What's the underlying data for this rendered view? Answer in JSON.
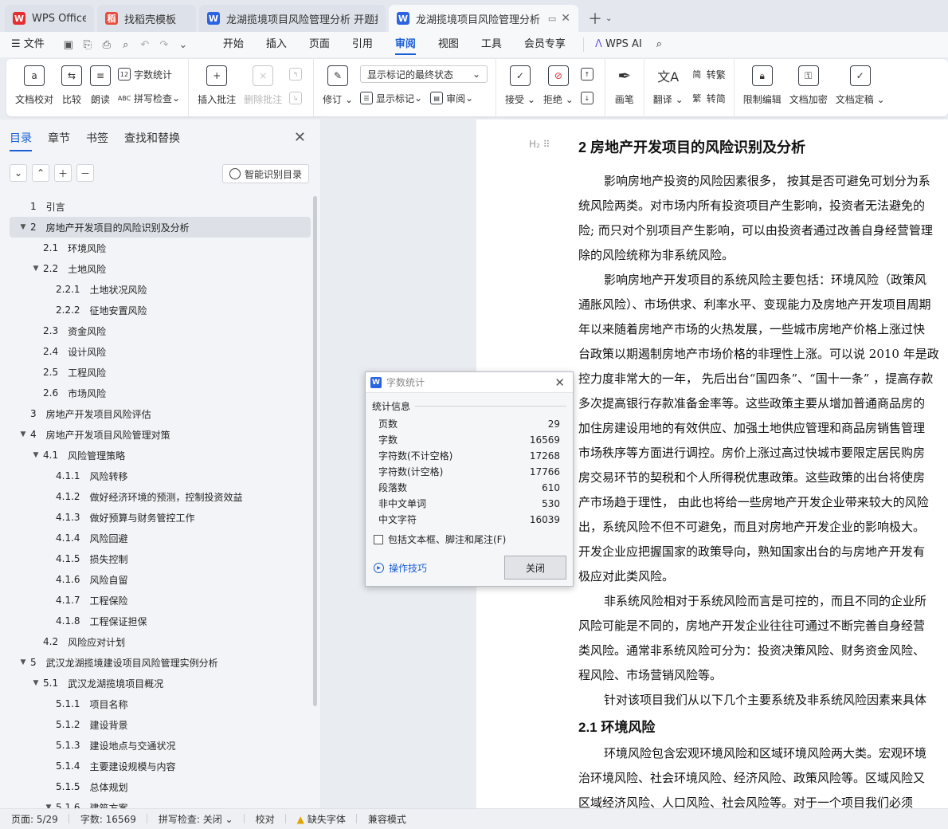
{
  "tabs": [
    {
      "label": "WPS Office",
      "icon": "wps-logo-icon",
      "color": "#e52e2e"
    },
    {
      "label": "找稻壳模板",
      "icon": "docer-icon",
      "color": "#e94c3d"
    },
    {
      "label": "龙湖揽境项目风险管理分析 开题报告",
      "icon": "writer-icon",
      "color": "#2b63e0"
    },
    {
      "label": "龙湖揽境项目风险管理分析 毕",
      "icon": "writer-icon",
      "color": "#2b63e0"
    }
  ],
  "menu": {
    "file": "文件",
    "items": [
      "开始",
      "插入",
      "页面",
      "引用",
      "审阅",
      "视图",
      "工具",
      "会员专享"
    ],
    "active": "审阅",
    "ai": "WPS AI"
  },
  "ribbon": {
    "doc_check": "文档校对",
    "compare": "比较",
    "read_aloud": "朗读",
    "word_count": "字数统计",
    "spell_check": "拼写检查",
    "insert_comment": "插入批注",
    "delete_comment": "删除批注",
    "revise": "修订",
    "markup_state": "显示标记的最终状态",
    "show_markup": "显示标记",
    "review": "审阅",
    "accept": "接受",
    "reject": "拒绝",
    "pen": "画笔",
    "translate": "翻译",
    "to_traditional": "转繁",
    "to_simplified": "转简",
    "restrict_edit": "限制编辑",
    "encrypt": "文档加密",
    "finalize": "文档定稿"
  },
  "panel": {
    "tabs": [
      "目录",
      "章节",
      "书签",
      "查找和替换"
    ],
    "smart_toc": "智能识别目录"
  },
  "toc": [
    {
      "num": "1",
      "title": "引言",
      "level": 1,
      "arrow": ""
    },
    {
      "num": "2",
      "title": "房地产开发项目的风险识别及分析",
      "level": 1,
      "arrow": "▼",
      "selected": true
    },
    {
      "num": "2.1",
      "title": "环境风险",
      "level": 2,
      "arrow": ""
    },
    {
      "num": "2.2",
      "title": "土地风险",
      "level": 2,
      "arrow": "▼"
    },
    {
      "num": "2.2.1",
      "title": "土地状况风险",
      "level": 3,
      "arrow": ""
    },
    {
      "num": "2.2.2",
      "title": "征地安置风险",
      "level": 3,
      "arrow": ""
    },
    {
      "num": "2.3",
      "title": "资金风险",
      "level": 2,
      "arrow": ""
    },
    {
      "num": "2.4",
      "title": "设计风险",
      "level": 2,
      "arrow": ""
    },
    {
      "num": "2.5",
      "title": "工程风险",
      "level": 2,
      "arrow": ""
    },
    {
      "num": "2.6",
      "title": "市场风险",
      "level": 2,
      "arrow": ""
    },
    {
      "num": "3",
      "title": "房地产开发项目风险评估",
      "level": 1,
      "arrow": ""
    },
    {
      "num": "4",
      "title": "房地产开发项目风险管理对策",
      "level": 1,
      "arrow": "▼"
    },
    {
      "num": "4.1",
      "title": "风险管理策略",
      "level": 2,
      "arrow": "▼"
    },
    {
      "num": "4.1.1",
      "title": "风险转移",
      "level": 3,
      "arrow": ""
    },
    {
      "num": "4.1.2",
      "title": "做好经济环境的预测，控制投资效益",
      "level": 3,
      "arrow": ""
    },
    {
      "num": "4.1.3",
      "title": "做好预算与财务管控工作",
      "level": 3,
      "arrow": ""
    },
    {
      "num": "4.1.4",
      "title": "风险回避",
      "level": 3,
      "arrow": ""
    },
    {
      "num": "4.1.5",
      "title": "损失控制",
      "level": 3,
      "arrow": ""
    },
    {
      "num": "4.1.6",
      "title": "风险自留",
      "level": 3,
      "arrow": ""
    },
    {
      "num": "4.1.7",
      "title": "工程保险",
      "level": 3,
      "arrow": ""
    },
    {
      "num": "4.1.8",
      "title": "工程保证担保",
      "level": 3,
      "arrow": ""
    },
    {
      "num": "4.2",
      "title": "风险应对计划",
      "level": 2,
      "arrow": ""
    },
    {
      "num": "5",
      "title": "武汉龙湖揽境建设项目风险管理实例分析",
      "level": 1,
      "arrow": "▼"
    },
    {
      "num": "5.1",
      "title": "武汉龙湖揽境项目概况",
      "level": 2,
      "arrow": "▼"
    },
    {
      "num": "5.1.1",
      "title": "项目名称",
      "level": 3,
      "arrow": ""
    },
    {
      "num": "5.1.2",
      "title": "建设背景",
      "level": 3,
      "arrow": ""
    },
    {
      "num": "5.1.3",
      "title": "建设地点与交通状况",
      "level": 3,
      "arrow": ""
    },
    {
      "num": "5.1.4",
      "title": "主要建设规模与内容",
      "level": 3,
      "arrow": ""
    },
    {
      "num": "5.1.5",
      "title": "总体规划",
      "level": 3,
      "arrow": ""
    },
    {
      "num": "5.1.6",
      "title": "建筑方案",
      "level": 3,
      "arrow": "▼"
    }
  ],
  "doc": {
    "heading_marker": "H₂",
    "h2": "2   房地产开发项目的风险识别及分析",
    "lines": [
      {
        "t": "影响房地产投资的风险因素很多，  按其是否可避免可划分为系",
        "indent": true
      },
      {
        "t": "统风险两类。对市场内所有投资项目产生影响，投资者无法避免的",
        "indent": false
      },
      {
        "t": "险; 而只对个别项目产生影响，可以由投资者通过改善自身经营管理",
        "indent": false
      },
      {
        "t": "除的风险统称为非系统风险。",
        "indent": false
      },
      {
        "t": "影响房地产开发项目的系统风险主要包括：环境风险（政策风",
        "indent": true
      },
      {
        "t": "通胀风险）、市场供求、利率水平、变现能力及房地产开发项目周期",
        "indent": false
      },
      {
        "t": "年以来随着房地产市场的火热发展，一些城市房地产价格上涨过快",
        "indent": false
      },
      {
        "t": "台政策以期遏制房地产市场价格的非理性上涨。可以说  2010 年是政",
        "indent": false
      },
      {
        "t": "控力度非常大的一年，  先后出台“国四条”、“国十一条” ，提高存款",
        "indent": false
      },
      {
        "t": "多次提高银行存款准备金率等。这些政策主要从增加普通商品房的",
        "indent": false
      },
      {
        "t": "加住房建设用地的有效供应、加强土地供应管理和商品房销售管理",
        "indent": false
      },
      {
        "t": "市场秩序等方面进行调控。房价上涨过高过快城市要限定居民购房",
        "indent": false
      },
      {
        "t": "房交易环节的契税和个人所得税优惠政策。这些政策的出台将使房",
        "indent": false
      },
      {
        "t": "产市场趋于理性，  由此也将给一些房地产开发企业带来较大的风险",
        "indent": false
      },
      {
        "t": "出，系统风险不但不可避免，而且对房地产开发企业的影响极大。",
        "indent": false
      },
      {
        "t": "开发企业应把握国家的政策导向，熟知国家出台的与房地产开发有",
        "indent": false
      },
      {
        "t": "极应对此类风险。",
        "indent": false
      },
      {
        "t": "非系统风险相对于系统风险而言是可控的，而且不同的企业所",
        "indent": true
      },
      {
        "t": "风险可能是不同的，房地产开发企业往往可通过不断完善自身经营",
        "indent": false
      },
      {
        "t": "类风险。通常非系统风险可分为：投资决策风险、财务资金风险、",
        "indent": false
      },
      {
        "t": "程风险、市场营销风险等。",
        "indent": false
      },
      {
        "t": "针对该项目我们从以下几个主要系统及非系统风险因素来具体",
        "indent": true
      }
    ],
    "h3": "2.1   环境风险",
    "lines2": [
      {
        "t": "环境风险包含宏观环境风险和区域环境风险两大类。宏观环境",
        "indent": true
      },
      {
        "t": "治环境风险、社会环境风险、经济风险、政策风险等。区域风险又",
        "indent": false
      },
      {
        "t": "区域经济风险、人口风险、社会风险等。对于一个项目我们必须",
        "indent": false
      }
    ]
  },
  "dialog": {
    "title": "字数统计",
    "section": "统计信息",
    "rows": [
      {
        "label": "页数",
        "value": "29"
      },
      {
        "label": "字数",
        "value": "16569"
      },
      {
        "label": "字符数(不计空格)",
        "value": "17268"
      },
      {
        "label": "字符数(计空格)",
        "value": "17766"
      },
      {
        "label": "段落数",
        "value": "610"
      },
      {
        "label": "非中文单词",
        "value": "530"
      },
      {
        "label": "中文字符",
        "value": "16039"
      }
    ],
    "include_label": "包括文本框、脚注和尾注(F)",
    "tips": "操作技巧",
    "close": "关闭"
  },
  "status": {
    "page": "页面: 5/29",
    "words": "字数: 16569",
    "spell": "拼写检查: 关闭",
    "proof": "校对",
    "missing_font": "缺失字体",
    "compat": "兼容模式"
  }
}
